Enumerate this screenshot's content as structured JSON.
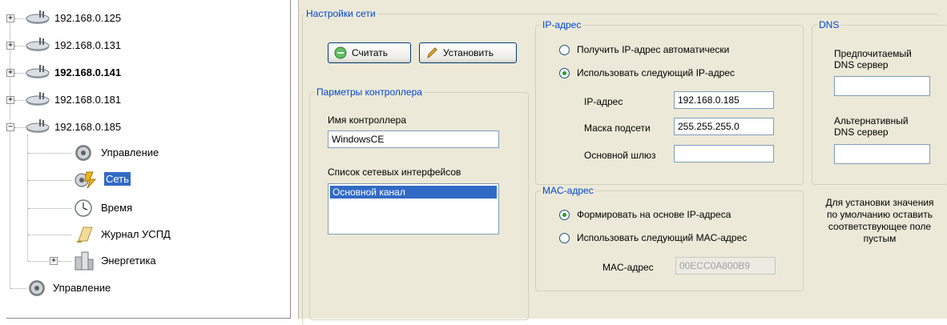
{
  "tree": {
    "nodes": [
      {
        "label": "192.168.0.125"
      },
      {
        "label": "192.168.0.131"
      },
      {
        "label": "192.168.0.141"
      },
      {
        "label": "192.168.0.181"
      },
      {
        "label": "192.168.0.185"
      }
    ],
    "children_185": [
      {
        "label": "Управление"
      },
      {
        "label": "Сеть"
      },
      {
        "label": "Время"
      },
      {
        "label": "Журнал УСПД"
      },
      {
        "label": "Энергетика"
      }
    ],
    "root_tail": {
      "label": "Управление"
    }
  },
  "network": {
    "group_title": "Настройки сети",
    "read_button": "Считать",
    "set_button": "Установить",
    "controller": {
      "group_title": "Парметры контроллера",
      "name_label": "Имя контроллера",
      "name_value": "WindowsCE",
      "interfaces_label": "Список сетевых интерфейсов",
      "interfaces": [
        "Основной канал"
      ]
    },
    "ip": {
      "group_title": "IP-адрес",
      "auto_label": "Получить IP-адрес автоматически",
      "manual_label": "Использовать следующий IP-адрес",
      "ip_label": "IP-адрес",
      "ip_value": "192.168.0.185",
      "mask_label": "Маска подсети",
      "mask_value": "255.255.255.0",
      "gateway_label": "Основной шлюз",
      "gateway_value": ""
    },
    "mac": {
      "group_title": "MAC-адрес",
      "from_ip_label": "Формировать на основе IP-адреса",
      "manual_label": "Использовать следующий MAC-адрес",
      "mac_label": "MAC-адрес",
      "mac_value": "00ECC0A800B9"
    },
    "dns": {
      "group_title": "DNS",
      "preferred_label_1": "Предпочитаемый",
      "preferred_label_2": "DNS сервер",
      "preferred_value": "",
      "alternate_label_1": "Альтернативный",
      "alternate_label_2": "DNS сервер",
      "alternate_value": ""
    },
    "hint": {
      "line1": "Для установки значения",
      "line2": "по умолчанию оставить",
      "line3": "соответствующее поле",
      "line4": "пустым"
    }
  },
  "colors": {
    "legend": "#0046d5",
    "selection": "#316ac5",
    "panel_bg": "#ece9d8"
  }
}
